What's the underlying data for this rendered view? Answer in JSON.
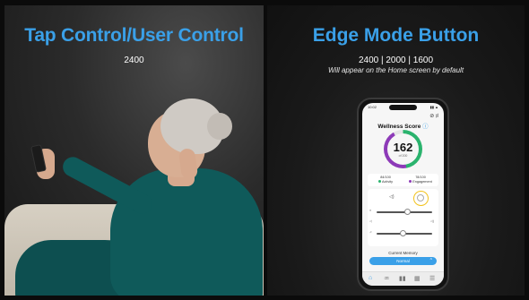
{
  "left_panel": {
    "title": "Tap Control/User Control",
    "subtitle": "2400"
  },
  "right_panel": {
    "title": "Edge Mode Button",
    "subtitle": "2400 | 2000 | 1600",
    "note": "Will appear on the Home screen by default"
  },
  "phone": {
    "status_time": "10:02",
    "status_right": "▮▮ ▲",
    "top_icons": "⊘ ♯",
    "wellness_title": "Wellness Score",
    "info_icon": "ⓘ",
    "score": "162",
    "score_of": "of 200",
    "metrics": [
      {
        "value": "84/100",
        "label": "Activity",
        "color": "#2ab36d"
      },
      {
        "value": "78/100",
        "label": "Engagement",
        "color": "#8d3ab8"
      }
    ],
    "card": {
      "volume_icon": "◁)",
      "slider_labels": [
        "≡",
        "◁",
        "◁)",
        "♫"
      ]
    },
    "current_memory_label": "Current Memory",
    "memory_value": "Normal",
    "memory_chevron": "^",
    "nav": [
      "⌂",
      "♒",
      "▮▮",
      "▦",
      "☰"
    ],
    "colors": {
      "accent": "#3aa0e8",
      "activity": "#2ab36d",
      "engagement": "#8d3ab8",
      "edge_highlight": "#f2c21b"
    }
  }
}
